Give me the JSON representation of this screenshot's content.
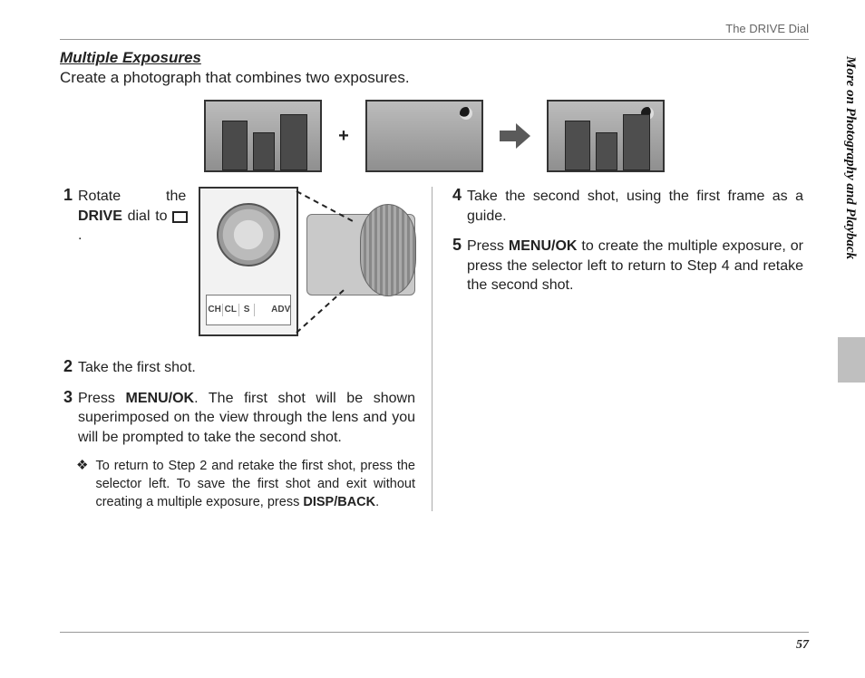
{
  "header": {
    "running": "The DRIVE Dial"
  },
  "side_tab": "More on Photography and Playback",
  "page_number": "57",
  "section": {
    "title": "Multiple Exposures",
    "lead": "Create a photograph that combines two exposures."
  },
  "hero": {
    "plus": "+"
  },
  "dial_scale": [
    "CH",
    "CL",
    "S",
    "",
    "ADV"
  ],
  "steps": {
    "s1": {
      "num": "1",
      "pre": "Rotate the ",
      "bold": "DRIVE",
      "post": " dial to ",
      "tail": "."
    },
    "s2": {
      "num": "2",
      "text": "Take the first shot."
    },
    "s3": {
      "num": "3",
      "pre": "Press ",
      "bold": "MENU/OK",
      "post": ".  The first shot will be shown superimposed on the view through the lens and you will be prompted to take the second shot."
    },
    "s4": {
      "num": "4",
      "text": "Take the second shot, using the first frame as a guide."
    },
    "s5": {
      "num": "5",
      "pre": "Press ",
      "bold": "MENU/OK",
      "post": " to create the multiple exposure, or press the selector left to return to Step 4 and retake the second shot."
    }
  },
  "note": {
    "bullet": "❖",
    "pre": "To return to Step 2 and retake the first shot, press the selector left.  To save the first shot and exit without creating a multiple exposure, press ",
    "bold": "DISP/BACK",
    "post": "."
  }
}
